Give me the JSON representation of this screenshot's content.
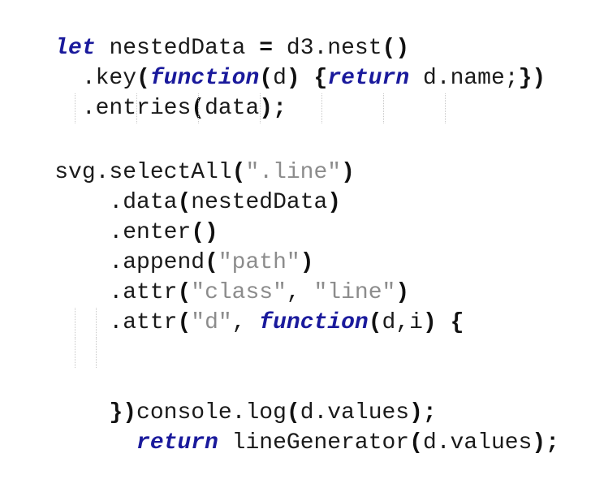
{
  "editor": {
    "lines": [
      [
        {
          "t": "let",
          "c": "kw"
        },
        {
          "t": " nestedData "
        },
        {
          "t": "=",
          "c": "p"
        },
        {
          "t": " d3.nest"
        },
        {
          "t": "()",
          "c": "p"
        }
      ],
      [
        {
          "t": "  .key"
        },
        {
          "t": "(",
          "c": "p"
        },
        {
          "t": "function",
          "c": "kw"
        },
        {
          "t": "(",
          "c": "p"
        },
        {
          "t": "d"
        },
        {
          "t": ")",
          "c": "p"
        },
        {
          "t": " "
        },
        {
          "t": "{",
          "c": "p"
        },
        {
          "t": "return",
          "c": "kw"
        },
        {
          "t": " d.name;"
        },
        {
          "t": "})",
          "c": "p"
        }
      ],
      [
        {
          "t": "  .entries"
        },
        {
          "t": "(",
          "c": "p"
        },
        {
          "t": "data"
        },
        {
          "t": ");",
          "c": "p"
        }
      ],
      [],
      [
        {
          "t": "svg.selectAll"
        },
        {
          "t": "(",
          "c": "p"
        },
        {
          "t": "\".line\"",
          "c": "str"
        },
        {
          "t": ")",
          "c": "p"
        }
      ],
      [
        {
          "t": "    .data"
        },
        {
          "t": "(",
          "c": "p"
        },
        {
          "t": "nestedData"
        },
        {
          "t": ")",
          "c": "p"
        }
      ],
      [
        {
          "t": "    .enter"
        },
        {
          "t": "()",
          "c": "p"
        }
      ],
      [
        {
          "t": "    .append"
        },
        {
          "t": "(",
          "c": "p"
        },
        {
          "t": "\"path\"",
          "c": "str"
        },
        {
          "t": ")",
          "c": "p"
        }
      ],
      [
        {
          "t": "    .attr"
        },
        {
          "t": "(",
          "c": "p"
        },
        {
          "t": "\"class\"",
          "c": "str"
        },
        {
          "t": ", "
        },
        {
          "t": "\"line\"",
          "c": "str"
        },
        {
          "t": ")",
          "c": "p"
        }
      ],
      [
        {
          "t": "    .attr"
        },
        {
          "t": "(",
          "c": "p"
        },
        {
          "t": "\"d\"",
          "c": "str"
        },
        {
          "t": ", "
        },
        {
          "t": "function",
          "c": "kw"
        },
        {
          "t": "(",
          "c": "p"
        },
        {
          "t": "d,i"
        },
        {
          "t": ")",
          "c": "p"
        },
        {
          "t": " "
        },
        {
          "t": "{",
          "c": "p"
        }
      ],
      [
        {
          "t": "      console.log"
        },
        {
          "t": "(",
          "c": "p"
        },
        {
          "t": "d.values"
        },
        {
          "t": ");",
          "c": "p"
        }
      ],
      [
        {
          "t": "      "
        },
        {
          "t": "return",
          "c": "kw"
        },
        {
          "t": " lineGenerator"
        },
        {
          "t": "(",
          "c": "p"
        },
        {
          "t": "d.values"
        },
        {
          "t": ");",
          "c": "p"
        }
      ],
      [
        {
          "t": "    "
        },
        {
          "t": "})",
          "c": "p"
        }
      ]
    ]
  }
}
